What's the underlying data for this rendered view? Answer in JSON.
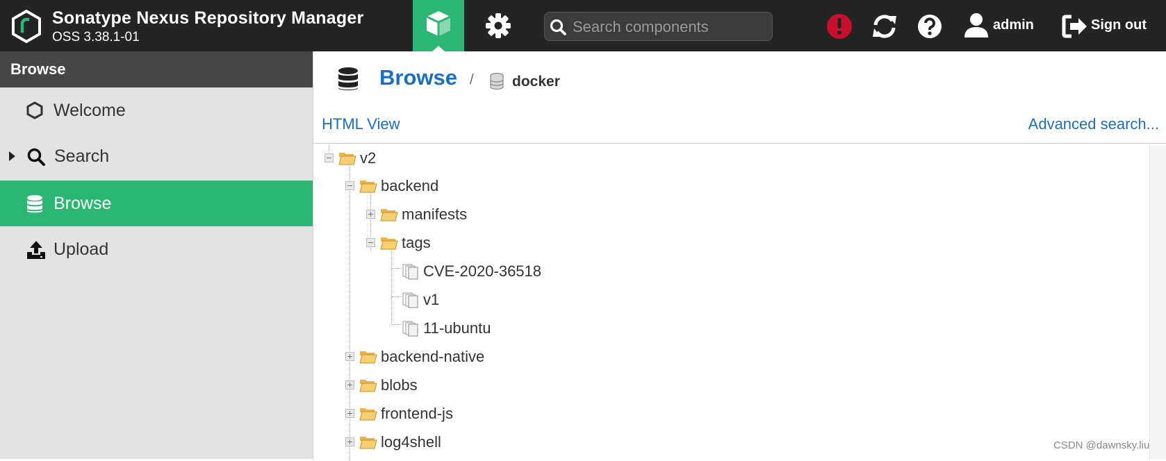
{
  "header": {
    "app_title": "Sonatype Nexus Repository Manager",
    "version": "OSS 3.38.1-01",
    "search_placeholder": "Search components",
    "user_label": "admin",
    "signout_label": "Sign out",
    "accent_color": "#2bb673",
    "alert_color": "#c8102e",
    "icons": [
      "nexus-logo-icon",
      "cube-icon",
      "gear-icon",
      "search-icon",
      "alert-icon",
      "refresh-icon",
      "help-icon",
      "user-icon",
      "sign-out-icon"
    ]
  },
  "sidebar": {
    "header": "Browse",
    "items": [
      {
        "label": "Welcome",
        "icon": "hexagon-icon"
      },
      {
        "label": "Search",
        "icon": "search-icon"
      },
      {
        "label": "Browse",
        "icon": "database-icon",
        "active": true
      },
      {
        "label": "Upload",
        "icon": "upload-icon"
      }
    ]
  },
  "breadcrumb": {
    "title": "Browse",
    "separator": "/",
    "repo": "docker"
  },
  "links": {
    "html_view": "HTML View",
    "advanced_search": "Advanced search..."
  },
  "tree": {
    "v2": "v2",
    "backend": "backend",
    "manifests": "manifests",
    "tags": "tags",
    "tag1": "CVE-2020-36518",
    "tag2": "v1",
    "tag3": "11-ubuntu",
    "backend_native": "backend-native",
    "blobs": "blobs",
    "frontend_js": "frontend-js",
    "log4shell": "log4shell"
  },
  "watermark": "CSDN @dawnsky.liu"
}
